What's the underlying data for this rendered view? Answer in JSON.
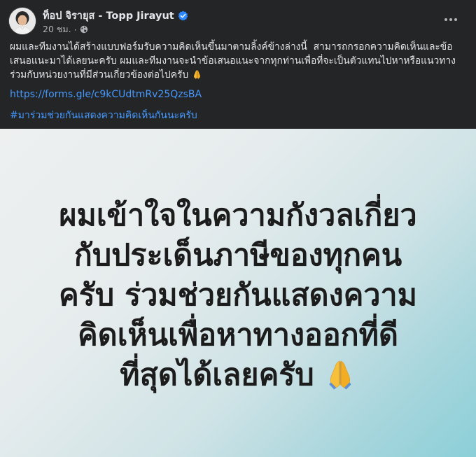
{
  "post": {
    "author_name": "ท็อป จิรายุส - Topp Jirayut",
    "timestamp": "20 ชม.",
    "separator": "·",
    "body_text": "ผมและทีมงานได้สร้างแบบฟอร์มรับความคิดเห็นขึ้นมาตามลิ้งค์ข้างล่างนี้  สามารถกรอกความคิดเห็นและข้อเสนอแนะมาได้เลยนะครับ ผมและทีมงานจะนำข้อเสนอแนะจากทุกท่านเพื่อที่จะเป็นตัวแทนไปหาหรือแนวทางร่วมกับหน่วยงานที่มีส่วนเกี่ยวข้องต่อไปครับ ",
    "link_text": "https://forms.gle/c9kCUdtmRv25QzsBA",
    "hashtag": "#มาร่วมช่วยกันแสดงความคิดเห็นกันนะครับ",
    "icons": {
      "verified": "verified-badge-icon",
      "audience": "globe-icon",
      "more": "more-options-icon",
      "emoji": "folded-hands-icon"
    },
    "colors": {
      "background": "#242526",
      "text": "#e4e6eb",
      "secondary_text": "#b0b3b8",
      "link": "#4599ff",
      "verified": "#2d88ff"
    }
  },
  "image": {
    "lines": [
      "ผมเข้าใจในความกังวลเกี่ยว",
      "กับประเด็นภาษีของทุกคน",
      "ครับ ร่วมช่วยกันแสดงความ",
      "คิดเห็นเพื่อหาทางออกที่ดี",
      "ที่สุดได้เลยครับ"
    ]
  }
}
